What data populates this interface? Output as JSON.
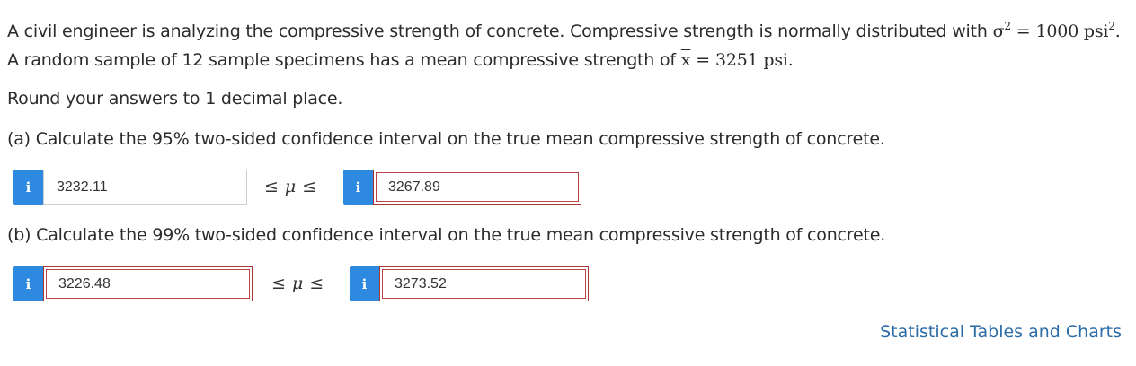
{
  "question": {
    "line1_text": "A civil engineer is analyzing the compressive strength of concrete. Compressive strength is normally distributed with ",
    "line1_math_sigma": "σ",
    "line1_math_exp": "2",
    "line1_math_eq": "=",
    "line1_math_value": "1000 psi",
    "line1_math_value_exp": "2",
    "line1_end": ".",
    "line2_text": "A random sample of 12 sample specimens has a mean compressive strength of ",
    "line2_math_x": "x",
    "line2_math_eq": "=",
    "line2_math_value": "3251 psi",
    "line2_end": ".",
    "instruction": "Round your answers to 1 decimal place."
  },
  "part_a": {
    "prompt": "(a) Calculate the 95% two-sided confidence interval on the true mean compressive strength of concrete.",
    "info_label": "i",
    "lower_value": "3232.11",
    "upper_value": "3267.89",
    "relation_left": "≤",
    "relation_mu": "μ",
    "relation_right": "≤"
  },
  "part_b": {
    "prompt": "(b) Calculate the 99% two-sided confidence interval on the true mean compressive strength of concrete.",
    "info_label": "i",
    "lower_value": "3226.48",
    "upper_value": "3273.52",
    "relation_left": "≤",
    "relation_mu": "μ",
    "relation_right": "≤"
  },
  "links": {
    "tables": "Statistical Tables and Charts"
  },
  "colors": {
    "info_button": "#2d8ae0",
    "error_border": "#b84646",
    "link": "#2b6ba6"
  }
}
